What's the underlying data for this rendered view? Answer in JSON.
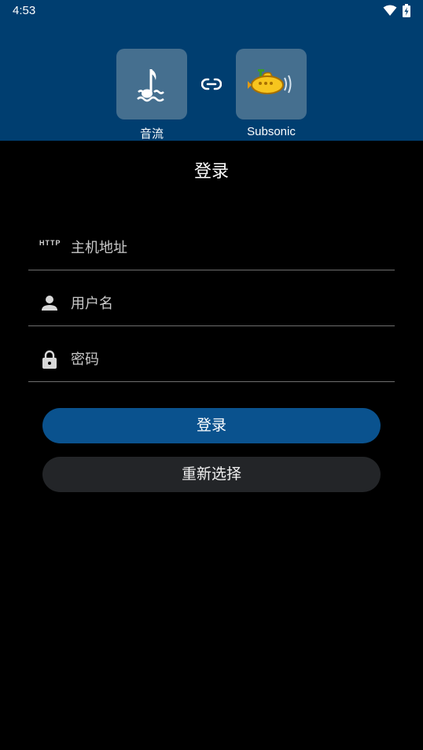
{
  "status_bar": {
    "time": "4:53"
  },
  "header": {
    "left_app_label": "音流",
    "right_app_label": "Subsonic",
    "left_app_icon": "music-note-wave-icon",
    "right_app_icon": "yellow-submarine-icon",
    "link_icon": "link-icon"
  },
  "page": {
    "title": "登录"
  },
  "form": {
    "host": {
      "icon_text": "HTTP",
      "placeholder": "主机地址",
      "value": ""
    },
    "username": {
      "icon": "person-icon",
      "placeholder": "用户名",
      "value": ""
    },
    "password": {
      "icon": "lock-icon",
      "placeholder": "密码",
      "value": ""
    }
  },
  "buttons": {
    "login_label": "登录",
    "reselect_label": "重新选择"
  },
  "colors": {
    "header_bg": "#003e70",
    "tile_bg": "#456f8f",
    "primary_button": "#0a528e",
    "secondary_button": "#232528",
    "background": "#000000"
  }
}
